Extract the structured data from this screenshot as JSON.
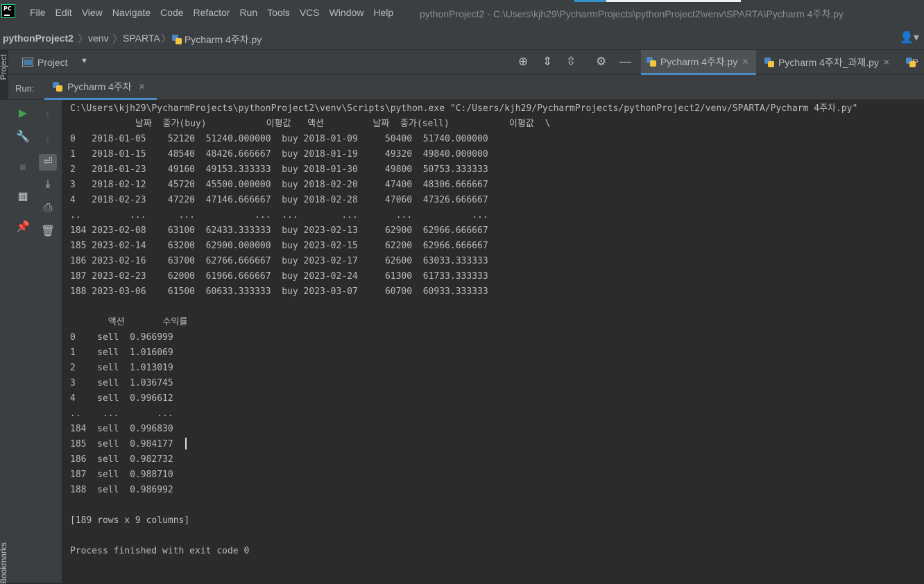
{
  "menubar": {
    "items": [
      "File",
      "Edit",
      "View",
      "Navigate",
      "Code",
      "Refactor",
      "Run",
      "Tools",
      "VCS",
      "Window",
      "Help"
    ],
    "title": "pythonProject2 - C:\\Users\\kjh29\\PycharmProjects\\pythonProject2\\venv\\SPARTA\\Pycharm 4주차.py",
    "logo_text": "PC"
  },
  "navbar": {
    "project": "pythonProject2",
    "crumbs": [
      "venv",
      "SPARTA",
      "Pycharm 4주차.py"
    ]
  },
  "project_panel": {
    "title": "Project"
  },
  "left_strip": {
    "top_label": "Project",
    "bottom_label": "Bookmarks"
  },
  "editor_tabs": [
    {
      "label": "Pycharm 4주차.py",
      "active": true
    },
    {
      "label": "Pycharm 4주차_과제.py",
      "active": false
    },
    {
      "label": "P",
      "active": false
    }
  ],
  "run": {
    "label": "Run:",
    "tab": "Pycharm 4주차"
  },
  "console": {
    "lines": [
      "C:\\Users\\kjh29\\PycharmProjects\\pythonProject2\\venv\\Scripts\\python.exe \"C:/Users/kjh29/PycharmProjects/pythonProject2/venv/SPARTA/Pycharm 4주차.py\"",
      "            날짜  종가(buy)           이평값   액션         날짜  종가(sell)           이평값  \\",
      "0   2018-01-05    52120  51240.000000  buy 2018-01-09     50400  51740.000000",
      "1   2018-01-15    48540  48426.666667  buy 2018-01-19     49320  49840.000000",
      "2   2018-01-23    49160  49153.333333  buy 2018-01-30     49800  50753.333333",
      "3   2018-02-12    45720  45500.000000  buy 2018-02-20     47400  48306.666667",
      "4   2018-02-23    47220  47146.666667  buy 2018-02-28     47060  47326.666667",
      "..         ...      ...           ...  ...        ...       ...           ...",
      "184 2023-02-08    63100  62433.333333  buy 2023-02-13     62900  62966.666667",
      "185 2023-02-14    63200  62900.000000  buy 2023-02-15     62200  62966.666667",
      "186 2023-02-16    63700  62766.666667  buy 2023-02-17     62600  63033.333333",
      "187 2023-02-23    62000  61966.666667  buy 2023-02-24     61300  61733.333333",
      "188 2023-03-06    61500  60633.333333  buy 2023-03-07     60700  60933.333333",
      "",
      "       액션       수익률",
      "0    sell  0.966999",
      "1    sell  1.016069",
      "2    sell  1.013019",
      "3    sell  1.036745",
      "4    sell  0.996612",
      "..    ...       ...",
      "184  sell  0.996830",
      "185  sell  0.984177",
      "186  sell  0.982732",
      "187  sell  0.988710",
      "188  sell  0.986992",
      "",
      "[189 rows x 9 columns]",
      "",
      "Process finished with exit code 0"
    ]
  },
  "colors": {
    "background": "#2b2b2b",
    "panel": "#3c3f41",
    "accent": "#4a88c7",
    "run_green": "#499c54",
    "text": "#bbbbbb"
  }
}
